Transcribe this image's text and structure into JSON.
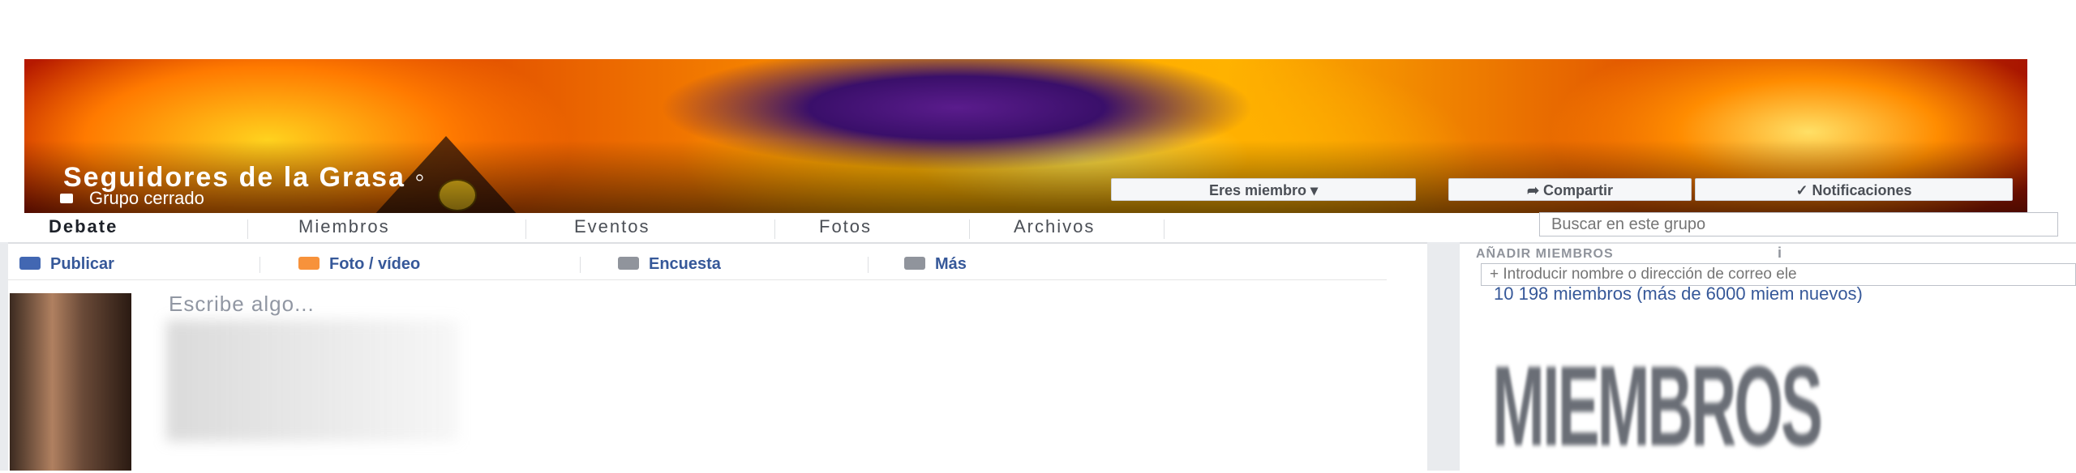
{
  "group": {
    "name": "Seguidores de la Grasa",
    "type_label": "Grupo cerrado"
  },
  "actions": {
    "member_label": "Eres miembro ▾",
    "share_label": "➦ Compartir",
    "notifications_label": "✓ Notificaciones"
  },
  "tabs": [
    {
      "label": "Debate",
      "active": true
    },
    {
      "label": "Miembros",
      "active": false
    },
    {
      "label": "Eventos",
      "active": false
    },
    {
      "label": "Fotos",
      "active": false
    },
    {
      "label": "Archivos",
      "active": false
    }
  ],
  "search": {
    "placeholder": "Buscar en este grupo"
  },
  "composer": {
    "items": [
      {
        "label": "Publicar",
        "icon": "pencil-icon",
        "color": "#4267b2"
      },
      {
        "label": "Foto / vídeo",
        "icon": "photo-icon",
        "color": "#f7923b"
      },
      {
        "label": "Encuesta",
        "icon": "poll-icon",
        "color": "#90949c"
      },
      {
        "label": "Más",
        "icon": "more-icon",
        "color": "#90949c"
      }
    ],
    "placeholder": "Escribe algo..."
  },
  "sidebar": {
    "add_members_heading": "AÑADIR MIEMBROS",
    "add_members_placeholder": "+ Introducir nombre o dirección de correo ele",
    "member_count": "10 198 miembros (más de 6000 miem nuevos)",
    "members_label": "MIEMBROS"
  },
  "colors": {
    "link": "#365899",
    "tab_border": "#dddfe2",
    "page_bg": "#e9ebee"
  }
}
